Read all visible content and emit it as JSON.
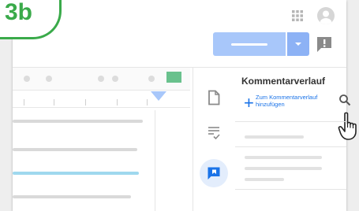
{
  "step_badge": {
    "label": "3b",
    "color": "#3aaa4a"
  },
  "header": {
    "apps_icon": "apps-grid-icon",
    "avatar_icon": "account-avatar-icon",
    "primary_button_color": "#a8c7fa",
    "dropdown_button_color": "#8db2f5",
    "feedback_icon": "feedback-exclamation-icon"
  },
  "document": {
    "accent_green": "#69c18d",
    "highlight_line_color": "#9fd8ee"
  },
  "side_rail": {
    "items": [
      {
        "icon": "document-icon",
        "active": false
      },
      {
        "icon": "list-check-icon",
        "active": false
      },
      {
        "icon": "comment-icon",
        "active": true
      }
    ]
  },
  "comments_panel": {
    "title": "Kommentarverlauf",
    "add_link_line1": "Zum Kommentarverlauf",
    "add_link_line2": "hinzufügen",
    "search_icon": "search-icon",
    "cursor": "hand-pointer-icon"
  }
}
